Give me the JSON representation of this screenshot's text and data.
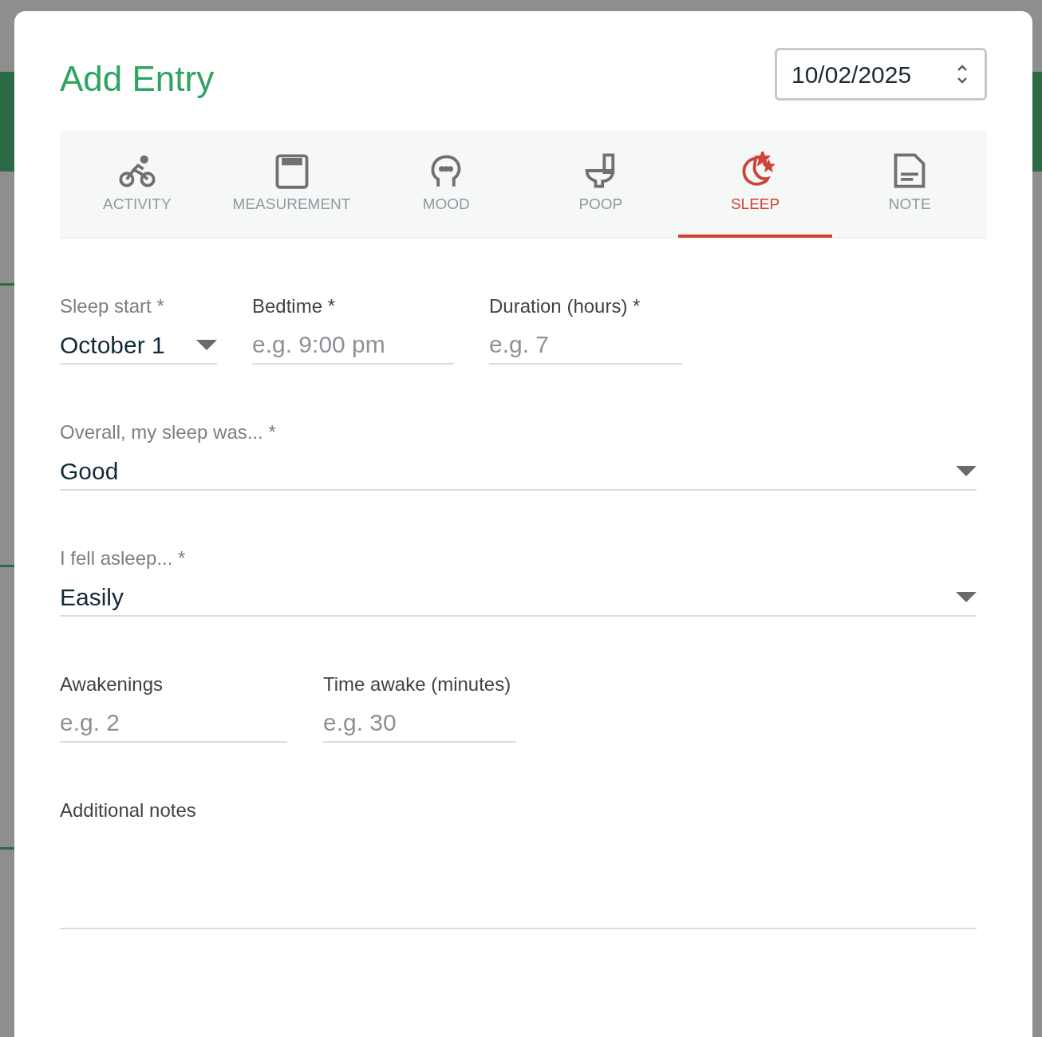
{
  "dialog": {
    "title": "Add Entry",
    "date": "10/02/2025"
  },
  "tabs": [
    {
      "label": "ACTIVITY",
      "selected": false
    },
    {
      "label": "MEASUREMENT",
      "selected": false
    },
    {
      "label": "MOOD",
      "selected": false
    },
    {
      "label": "POOP",
      "selected": false
    },
    {
      "label": "SLEEP",
      "selected": true
    },
    {
      "label": "NOTE",
      "selected": false
    }
  ],
  "rows": [
    [
      {
        "kind": "select",
        "label": "Sleep start *",
        "value": "October 1"
      },
      {
        "kind": "input",
        "label": "Bedtime *",
        "placeholder": "e.g. 9:00 pm"
      },
      {
        "kind": "input",
        "label": "Duration (hours) *",
        "placeholder": "e.g. 7"
      }
    ],
    [
      {
        "kind": "select",
        "label": "Overall, my sleep was... *",
        "value": "Good"
      }
    ],
    [
      {
        "kind": "select",
        "label": "I fell asleep... *",
        "value": "Easily"
      }
    ],
    [
      {
        "kind": "input",
        "label": "Awakenings",
        "placeholder": "e.g. 2"
      },
      {
        "kind": "input",
        "label": "Time awake (minutes)",
        "placeholder": "e.g. 30"
      }
    ],
    [
      {
        "kind": "textarea",
        "label": "Additional notes"
      }
    ]
  ]
}
